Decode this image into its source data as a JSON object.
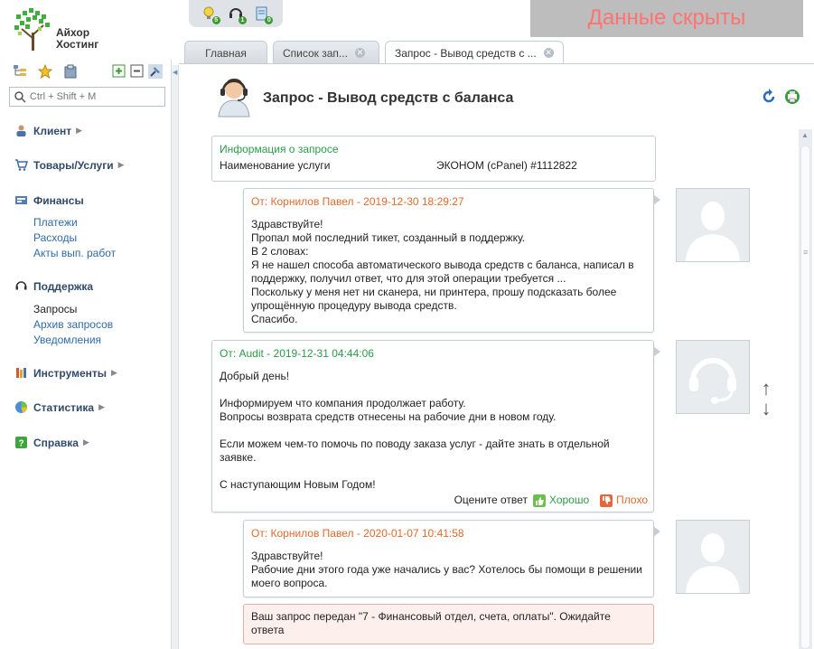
{
  "logo": {
    "line1": "Айхор",
    "line2": "Хостинг"
  },
  "hidden_banner": "Данные скрыты",
  "top_icons": [
    {
      "icon": "bulb-icon",
      "badge": "5"
    },
    {
      "icon": "headset-icon",
      "badge": "1"
    },
    {
      "icon": "document-icon",
      "badge": "0"
    }
  ],
  "tabs": [
    {
      "label": "Главная",
      "closable": false
    },
    {
      "label": "Список зап...",
      "closable": true
    },
    {
      "label": "Запрос - Вывод средств с ...",
      "closable": true,
      "active": true
    }
  ],
  "sidebar": {
    "search_placeholder": "Ctrl + Shift + M",
    "sections": [
      {
        "label": "Клиент",
        "icon": "user-icon",
        "arrow": "▶"
      },
      {
        "label": "Товары/Услуги",
        "icon": "cart-icon",
        "arrow": "▶"
      },
      {
        "label": "Финансы",
        "icon": "finance-icon",
        "items": [
          "Платежи",
          "Расходы",
          "Акты вып. работ"
        ]
      },
      {
        "label": "Поддержка",
        "icon": "support-icon",
        "items": [
          "Запросы",
          "Архив запросов",
          "Уведомления"
        ]
      },
      {
        "label": "Инструменты",
        "icon": "tools-icon",
        "arrow": "▶"
      },
      {
        "label": "Статистика",
        "icon": "stats-icon",
        "arrow": "▶"
      },
      {
        "label": "Справка",
        "icon": "help-icon",
        "arrow": "▶"
      }
    ]
  },
  "page": {
    "title": "Запрос - Вывод средств с баланса"
  },
  "info": {
    "title": "Информация о запросе",
    "key": "Наименование услуги",
    "value": "ЭКОНОМ (cPanel) #1112822"
  },
  "messages": [
    {
      "from": "От: Корнилов Павел - 2019-12-30 18:29:27",
      "lines": [
        "Здравствуйте!",
        "Пропал мой последний тикет, созданный в поддержку.",
        "В 2 словах:",
        "Я не нашел способа автоматического вывода средств с баланса, написал в поддержку, получил ответ, что для этой операции требуется ...",
        "Поскольку у меня нет ни сканера, ни принтера, прошу подсказать более упрощённую процедуру вывода средств.",
        "Спасибо."
      ]
    },
    {
      "from": "От: Audit - 2019-12-31 04:44:06",
      "lines": [
        "Добрый день!",
        "",
        "Информируем что компания продолжает работу.",
        "Вопросы возврата средств отнесены на рабочие дни в новом году.",
        "",
        "Если можем чем-то помочь по поводу заказа услуг - дайте знать в отдельной заявке.",
        "",
        "С наступающим Новым Годом!"
      ],
      "rating": {
        "label": "Оцените ответ",
        "good": "Хорошо",
        "bad": "Плохо"
      }
    },
    {
      "from": "От: Корнилов Павел - 2020-01-07 10:41:58",
      "lines": [
        "Здравствуйте!",
        "Рабочие дни этого года уже начались у вас? Хотелось бы помощи в решении моего вопроса."
      ]
    }
  ],
  "notice": "Ваш запрос передан \"7 - Финансовый отдел, счета, оплаты\". Ожидайте ответа",
  "colors": {
    "green": "#2b9b4a",
    "orange": "#e06a2c",
    "nav": "#2f4a6b",
    "link": "#2f6aa8"
  }
}
